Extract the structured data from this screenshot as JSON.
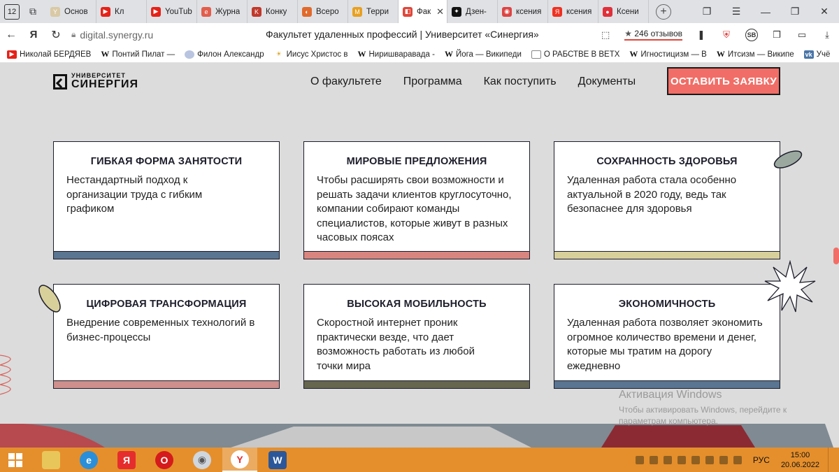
{
  "browser": {
    "tab_counter": "12",
    "tabs": [
      {
        "title": "Основ",
        "fav_color": "#d9c9a4",
        "fav_glyph": "Y"
      },
      {
        "title": "Кл",
        "fav_color": "#e62117",
        "fav_glyph": "▶"
      },
      {
        "title": "YouTub",
        "fav_color": "#e62117",
        "fav_glyph": "▶"
      },
      {
        "title": "Журна",
        "fav_color": "#e25d4b",
        "fav_glyph": "e"
      },
      {
        "title": "Конку",
        "fav_color": "#c0392b",
        "fav_glyph": "K"
      },
      {
        "title": "Всеро",
        "fav_color": "#e06a2c",
        "fav_glyph": "◐"
      },
      {
        "title": "Терри",
        "fav_color": "#e8a020",
        "fav_glyph": "M"
      },
      {
        "title": "Фак",
        "fav_color": "#e0473a",
        "fav_glyph": "◧",
        "active": true
      },
      {
        "title": "Дзен-",
        "fav_color": "#111111",
        "fav_glyph": "✦"
      },
      {
        "title": "ксения",
        "fav_color": "#d44",
        "fav_glyph": "◉"
      },
      {
        "title": "ксения",
        "fav_color": "#f03020",
        "fav_glyph": "Я"
      },
      {
        "title": "Ксени",
        "fav_color": "#e0303a",
        "fav_glyph": "●"
      }
    ],
    "url": "digital.synergy.ru",
    "page_title": "Факультет удаленных профессий | Университет «Синергия»",
    "reviews": "246 отзывов"
  },
  "bookmarks": [
    {
      "label": "Николай БЕРДЯЕВ",
      "type": "yt"
    },
    {
      "label": "Понтий Пилат —",
      "type": "w"
    },
    {
      "label": "Филон Александр",
      "type": "circle"
    },
    {
      "label": "Иисус Христос в",
      "type": "sun"
    },
    {
      "label": "Ниришваравада -",
      "type": "w"
    },
    {
      "label": "Йога — Википеди",
      "type": "w"
    },
    {
      "label": "О РАБСТВЕ В ВЕТХ",
      "type": "doc"
    },
    {
      "label": "Игностицизм — В",
      "type": "w"
    },
    {
      "label": "Итсизм — Википе",
      "type": "w"
    },
    {
      "label": "Учё",
      "type": "vk"
    }
  ],
  "site": {
    "logo_line1": "УНИВЕРСИТЕТ",
    "logo_line2": "СИНЕРГИЯ",
    "nav": [
      "О факультете",
      "Программа",
      "Как поступить",
      "Документы"
    ],
    "cta": "ОСТАВИТЬ ЗАЯВКУ"
  },
  "cards": [
    {
      "title": "ГИБКАЯ ФОРМА ЗАНЯТОСТИ",
      "text": "Нестандартный подход к организации труда с гибким графиком",
      "stripe": "#5a7591"
    },
    {
      "title": "МИРОВЫЕ ПРЕДЛОЖЕНИЯ",
      "text": "Чтобы расширять свои возможности и решать задачи клиентов круглосуточно, компании собирают команды специалистов, которые живут в разных часовых поясах",
      "stripe": "#d9857f"
    },
    {
      "title": "СОХРАННОСТЬ ЗДОРОВЬЯ",
      "text": "Удаленная работа стала особенно актуальной в 2020 году, ведь так безопаснее для здоровья",
      "stripe": "#d8d09b"
    },
    {
      "title": "ЦИФРОВАЯ ТРАНСФОРМАЦИЯ",
      "text": "Внедрение современных технологий в бизнес-процессы",
      "stripe": "#cf8f8c"
    },
    {
      "title": "ВЫСОКАЯ МОБИЛЬНОСТЬ",
      "text": "Скоростной интернет проник практически везде, что дает возможность работать из любой точки мира",
      "stripe": "#66664f"
    },
    {
      "title": "ЭКОНОМИЧНОСТЬ",
      "text": "Удаленная работа позволяет экономить огромное количество времени и денег, которые мы тратим на дорогу ежедневно",
      "stripe": "#5a7591"
    }
  ],
  "watermark": {
    "line1": "Активация Windows",
    "line2": "Чтобы активировать Windows, перейдите к",
    "line3": "параметрам компьютера."
  },
  "taskbar": {
    "lang": "РУС",
    "time": "15:00",
    "date": "20.06.2022"
  }
}
